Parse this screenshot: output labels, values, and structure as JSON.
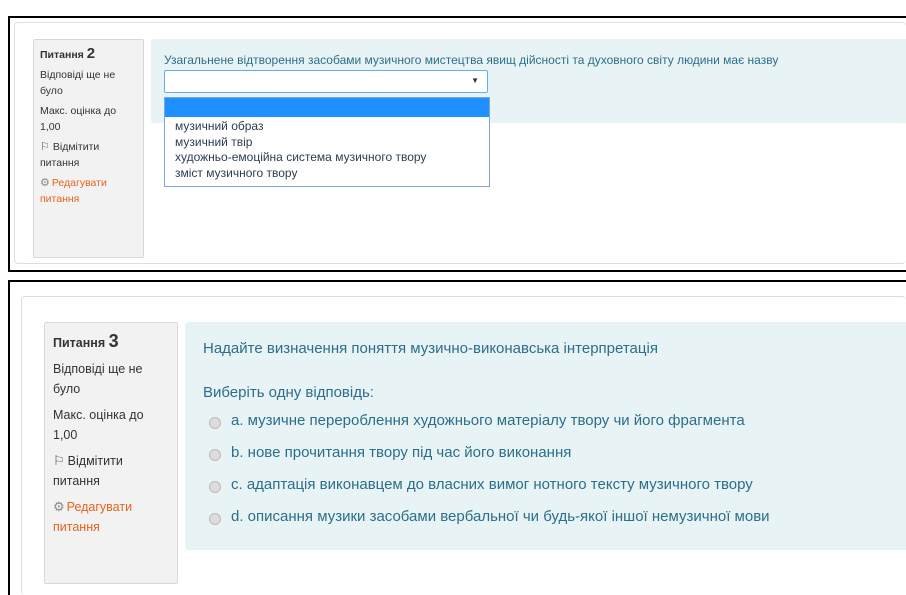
{
  "question2": {
    "label": "Питання",
    "number": "2",
    "status": "Відповіді ще не було",
    "max_grade": "Макс. оцінка до 1,00",
    "flag": "Відмітити питання",
    "edit": "Редагувати питання",
    "text": "Узагальнене відтворення засобами музичного мистецтва явищ дійсності та духовного світу людини має назву",
    "select_value": "",
    "dropdown_options": [
      "музичний образ",
      "музичний твір",
      "художньо-емоційна система музичного твору",
      "зміст музичного твору"
    ]
  },
  "question3": {
    "label": "Питання",
    "number": "3",
    "status": "Відповіді ще не було",
    "max_grade": "Макс. оцінка до 1,00",
    "flag": "Відмітити питання",
    "edit": "Редагувати питання",
    "text": "Надайте визначення поняття музично-виконавська інтерпретація",
    "prompt": "Виберіть одну відповідь:",
    "answers": [
      "a. музичне перероблення художнього матеріалу твору чи його фрагмента",
      "b. нове прочитання твору під час його виконання",
      "c. адаптація виконавцем до власних вимог нотного тексту музичного твору",
      "d. описання музики засобами вербальної чи будь-якої іншої немузичної мови"
    ]
  },
  "colors": {
    "accent_text": "#2c6e8a",
    "content_bg": "#e7f3f5",
    "info_bg": "#f2f2f2",
    "edit_link": "#e8631d",
    "selected_option": "#1e90ff"
  },
  "icons": [
    "flag-icon",
    "gear-icon",
    "dropdown-arrow-icon"
  ]
}
